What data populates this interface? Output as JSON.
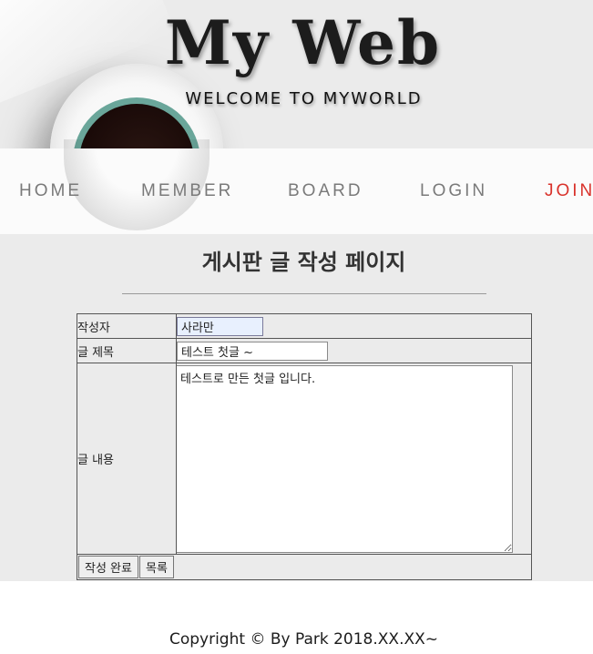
{
  "header": {
    "title": "My Web",
    "subtitle": "WELCOME TO MYWORLD"
  },
  "nav": {
    "items": [
      "HOME",
      "MEMBER",
      "BOARD",
      "LOGIN",
      "JOIN"
    ],
    "active_color": "#d9322b"
  },
  "main": {
    "heading": "게시판 글 작성 페이지",
    "form": {
      "author_label": "작성자",
      "author_value": "사라만",
      "title_label": "글 제목",
      "title_value": "테스트 첫글 ~",
      "content_label": "글 내용",
      "content_value": "테스트로 만든 첫글 입니다.",
      "submit_label": "작성 완료",
      "list_label": "목록"
    }
  },
  "footer": {
    "copyright": "Copyright © By Park 2018.XX.XX~"
  }
}
